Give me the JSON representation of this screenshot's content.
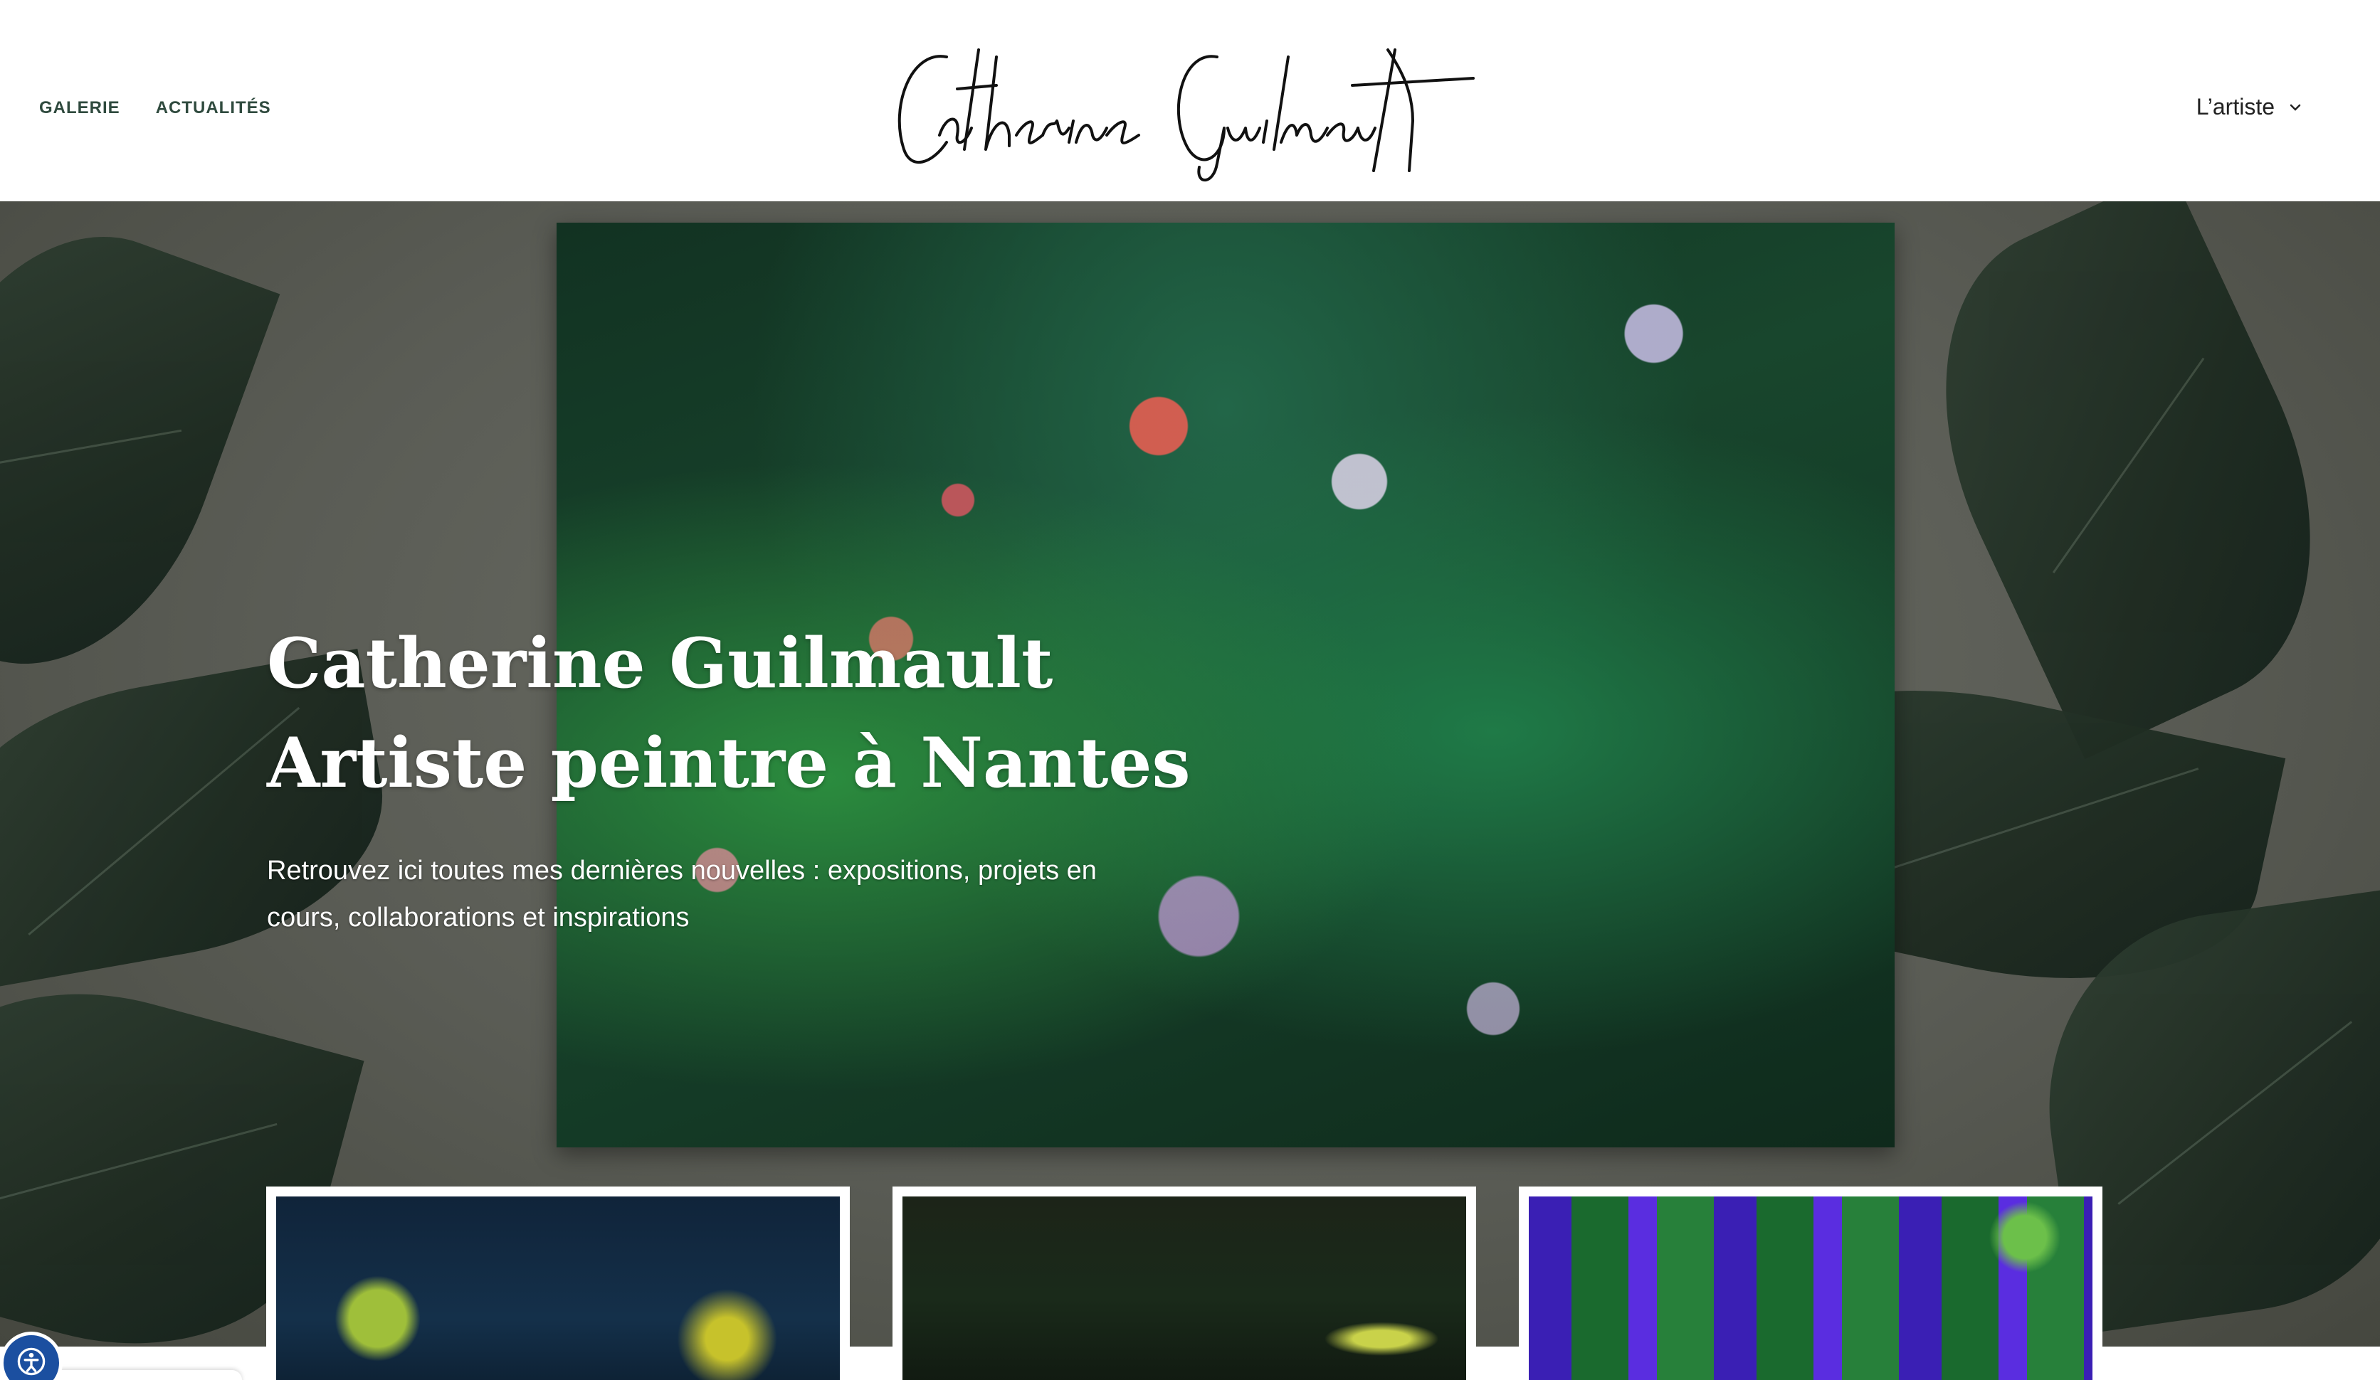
{
  "header": {
    "nav_left": [
      {
        "label": "GALERIE"
      },
      {
        "label": "ACTUALITÉS"
      }
    ],
    "logo_text": "Catherine Guilmault",
    "nav_right": {
      "label": "L’artiste",
      "icon": "chevron-down-icon"
    }
  },
  "hero": {
    "title_line1": "Catherine Guilmault",
    "title_line2": "Artiste peintre à Nantes",
    "text": "Retrouvez ici toutes mes dernières nouvelles : expositions, projets en cours, collaborations et inspirations"
  },
  "cards": [
    {
      "id": "card-1"
    },
    {
      "id": "card-2"
    },
    {
      "id": "card-3"
    }
  ],
  "accessibility_widget": {
    "icon": "accessibility-icon"
  },
  "colors": {
    "nav_text": "#2f4a3e",
    "accent_blue": "#1b4fa0",
    "hero_text": "#ffffff"
  }
}
